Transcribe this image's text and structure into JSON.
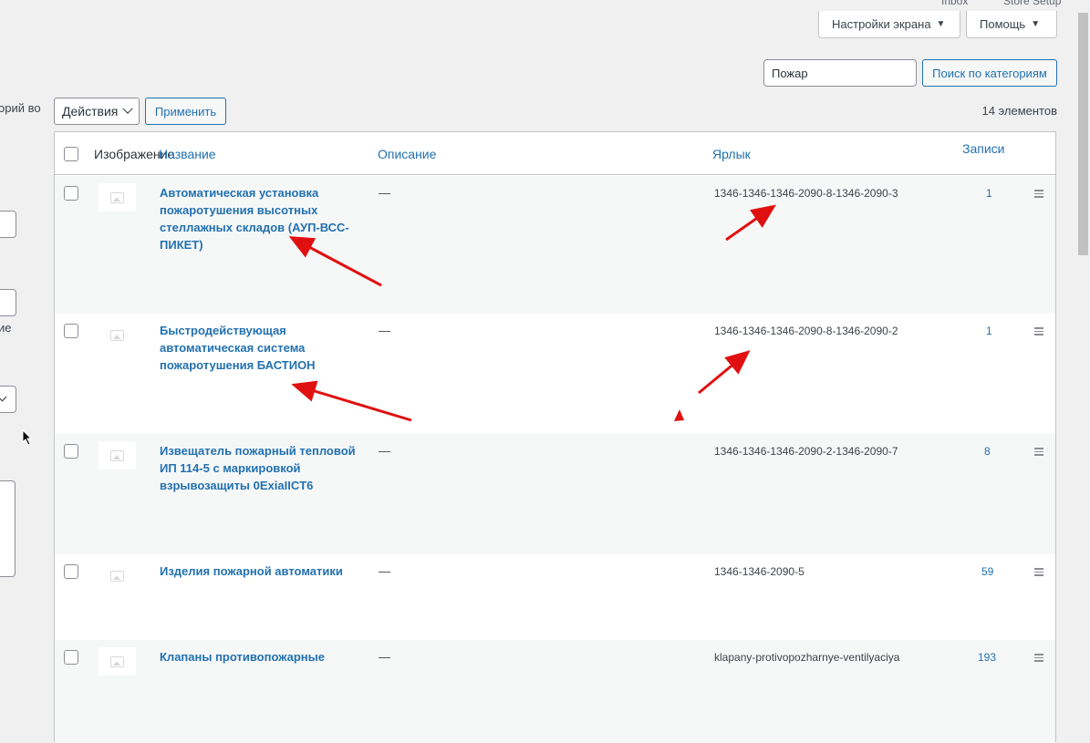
{
  "top_links": {
    "inbox": "Inbox",
    "store_setup": "Store Setup"
  },
  "header": {
    "screen_options": "Настройки экрана",
    "help": "Помощь"
  },
  "search": {
    "value": "Пожар",
    "button": "Поиск по категориям"
  },
  "bulk": {
    "actions": "Действия",
    "apply": "Применить"
  },
  "items_count": "14 элементов",
  "left_form": {
    "fragment_1": "орий во",
    "fragment_2": "ие"
  },
  "table": {
    "columns": {
      "image": "Изображение",
      "name": "Название",
      "description": "Описание",
      "slug": "Ярлык",
      "count": "Записи"
    },
    "rows": [
      {
        "name": "Автоматическая установка пожаротушения высотных стеллажных складов (АУП-ВСС-ПИКЕТ)",
        "description": "—",
        "slug": "1346-1346-1346-2090-8-1346-2090-3",
        "count": "1"
      },
      {
        "name": "Быстродействующая автоматическая система пожаротушения БАСТИОН",
        "description": "—",
        "slug": "1346-1346-1346-2090-8-1346-2090-2",
        "count": "1"
      },
      {
        "name": "Извещатель пожарный тепловой ИП 114-5 с маркировкой взрывозащиты 0ExiaIICT6",
        "description": "—",
        "slug": "1346-1346-1346-2090-2-1346-2090-7",
        "count": "8"
      },
      {
        "name": "Изделия пожарной автоматики",
        "description": "—",
        "slug": "1346-1346-2090-5",
        "count": "59"
      },
      {
        "name": "Клапаны противопожарные",
        "description": "—",
        "slug": "klapany-protivopozharnye-ventilyaciya",
        "count": "193"
      }
    ]
  },
  "colors": {
    "link": "#2271b1",
    "annotation_arrow": "#e01010"
  }
}
